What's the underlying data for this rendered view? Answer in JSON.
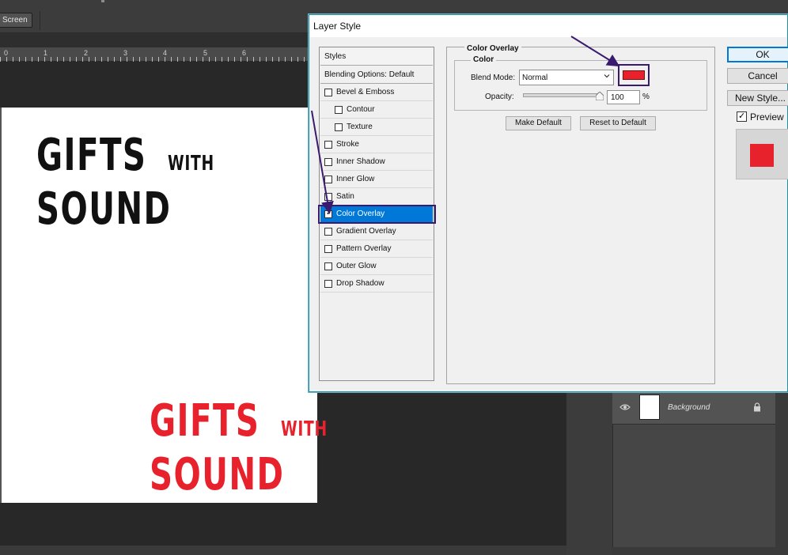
{
  "toolbar": {
    "screen_label": "Screen"
  },
  "ruler": {
    "nums": [
      "0",
      "1",
      "2",
      "3",
      "4",
      "5",
      "6"
    ]
  },
  "canvas": {
    "top_text": {
      "line1": "GIFTS",
      "line1_small": "WITH",
      "line2": "SOUND"
    },
    "bottom_text": {
      "line1": "GIFTS",
      "line1_small": "WITH",
      "line2": "SOUND"
    },
    "overlay_color": "#e8222d"
  },
  "layers": {
    "background_name": "Background"
  },
  "dialog": {
    "title": "Layer Style",
    "styles_header": "Styles",
    "blending_options": "Blending Options: Default",
    "items": [
      {
        "label": "Bevel & Emboss",
        "checked": false,
        "indent": false
      },
      {
        "label": "Contour",
        "checked": false,
        "indent": true
      },
      {
        "label": "Texture",
        "checked": false,
        "indent": true
      },
      {
        "label": "Stroke",
        "checked": false,
        "indent": false
      },
      {
        "label": "Inner Shadow",
        "checked": false,
        "indent": false
      },
      {
        "label": "Inner Glow",
        "checked": false,
        "indent": false
      },
      {
        "label": "Satin",
        "checked": false,
        "indent": false
      },
      {
        "label": "Color Overlay",
        "checked": true,
        "indent": false,
        "selected": true
      },
      {
        "label": "Gradient Overlay",
        "checked": false,
        "indent": false
      },
      {
        "label": "Pattern Overlay",
        "checked": false,
        "indent": false
      },
      {
        "label": "Outer Glow",
        "checked": false,
        "indent": false
      },
      {
        "label": "Drop Shadow",
        "checked": false,
        "indent": false
      }
    ],
    "panel": {
      "section_title": "Color Overlay",
      "group_title": "Color",
      "blend_mode_label": "Blend Mode:",
      "blend_mode_value": "Normal",
      "opacity_label": "Opacity:",
      "opacity_value": "100",
      "opacity_unit": "%",
      "make_default": "Make Default",
      "reset_default": "Reset to Default",
      "color": "#e8222d"
    },
    "buttons": {
      "ok": "OK",
      "cancel": "Cancel",
      "new_style": "New Style..."
    },
    "preview_label": "Preview",
    "preview_checked": true
  }
}
